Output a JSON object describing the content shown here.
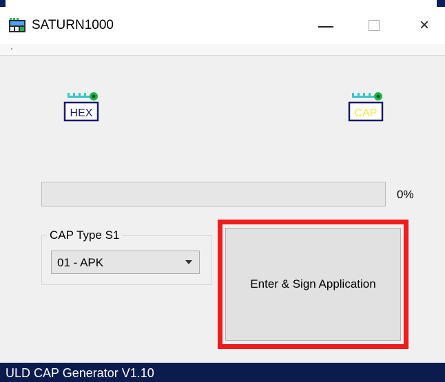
{
  "window": {
    "title": "SATURN1000",
    "controls": {
      "minimize": "minimize",
      "maximize": "maximize",
      "close": "×"
    }
  },
  "icons": {
    "app": "terminal-device-icon",
    "hex_file": {
      "label": "HEX",
      "icon": "hex-file-icon"
    },
    "cap_file": {
      "label": "CAP",
      "icon": "cap-file-icon"
    }
  },
  "progress": {
    "value": 0,
    "text": "0%"
  },
  "cap_type": {
    "group_label": "CAP Type S1",
    "selected": "01 - APK"
  },
  "action_button": {
    "label": "Enter & Sign Application"
  },
  "status_bar": {
    "text": "ULD CAP Generator V1.10"
  },
  "colors": {
    "status_bar": "#0c1b4d",
    "highlight": "#ee1c1c",
    "hex_label": "#1a1a6e",
    "cap_label": "#f5e642",
    "icon_teal": "#39c6c6",
    "icon_green": "#22b14c"
  }
}
